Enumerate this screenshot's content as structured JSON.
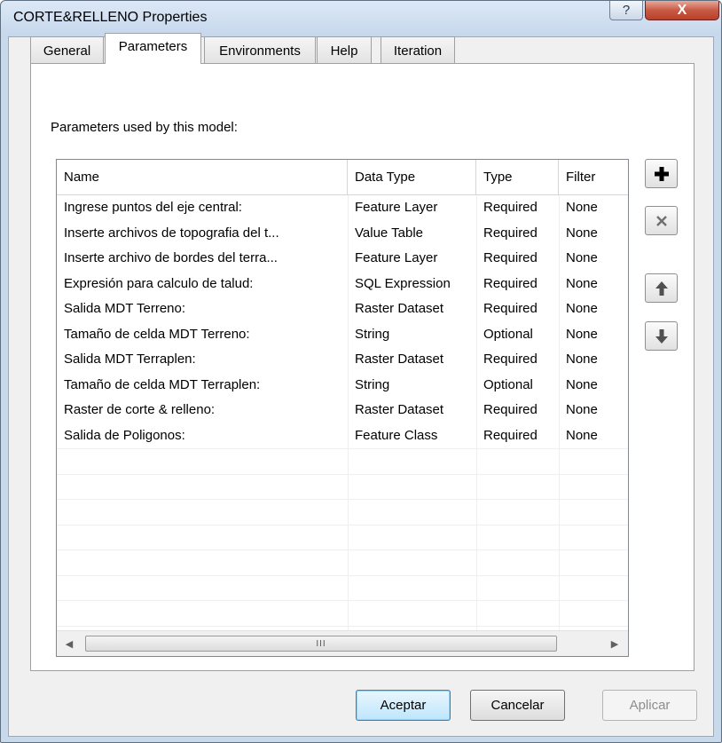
{
  "window": {
    "title": "CORTE&RELLENO Properties",
    "help_glyph": "?",
    "close_glyph": "X"
  },
  "tabs": [
    {
      "label": "General",
      "active": false
    },
    {
      "label": "Parameters",
      "active": true
    },
    {
      "label": "Environments",
      "active": false
    },
    {
      "label": "Help",
      "active": false
    },
    {
      "label": "Iteration",
      "active": false
    }
  ],
  "parameters": {
    "section_label": "Parameters used by this model:",
    "columns": [
      "Name",
      "Data Type",
      "Type",
      "Filter"
    ],
    "rows": [
      [
        "Ingrese puntos del eje central:",
        "Feature Layer",
        "Required",
        "None"
      ],
      [
        "Inserte archivos de topografia del t...",
        "Value Table",
        "Required",
        "None"
      ],
      [
        "Inserte archivo de bordes del terra...",
        "Feature Layer",
        "Required",
        "None"
      ],
      [
        "Expresión para calculo de talud:",
        "SQL Expression",
        "Required",
        "None"
      ],
      [
        "Salida MDT Terreno:",
        "Raster Dataset",
        "Required",
        "None"
      ],
      [
        "Tamaño de celda MDT Terreno:",
        "String",
        "Optional",
        "None"
      ],
      [
        "Salida MDT Terraplen:",
        "Raster Dataset",
        "Required",
        "None"
      ],
      [
        "Tamaño de celda MDT Terraplen:",
        "String",
        "Optional",
        "None"
      ],
      [
        "Raster de corte & relleno:",
        "Raster Dataset",
        "Required",
        "None"
      ],
      [
        "Salida de Poligonos:",
        "Feature Class",
        "Required",
        "None"
      ]
    ],
    "scroll_thumb_grip": "III",
    "side_buttons": {
      "add": "plus-icon",
      "remove": "x-icon",
      "up": "arrow-up-icon",
      "down": "arrow-down-icon"
    }
  },
  "buttons": {
    "ok": "Aceptar",
    "cancel": "Cancelar",
    "apply": "Aplicar"
  },
  "colors": {
    "titlebar": "#c6d7ec",
    "close_button": "#c85a45",
    "default_button_border": "#3c7fb1"
  }
}
